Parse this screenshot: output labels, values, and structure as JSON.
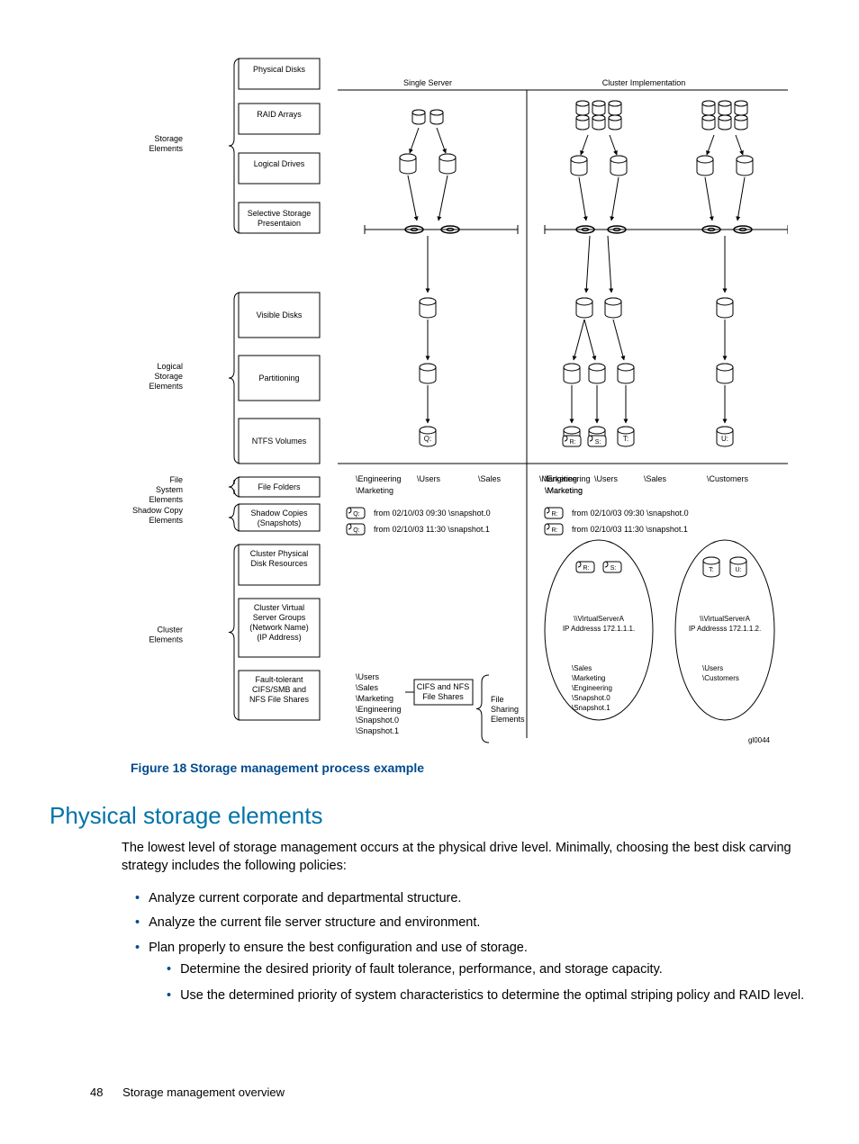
{
  "diagram": {
    "columns": {
      "single": "Single Server",
      "cluster": "Cluster Implementation"
    },
    "groups": {
      "storage": {
        "label": "Storage\nElements",
        "rows": [
          "Physical Disks",
          "RAID Arrays",
          "Logical Drives",
          "Selective Storage\nPresentaion"
        ]
      },
      "logical": {
        "label": "Logical\nStorage\nElements",
        "rows": [
          "Visible Disks",
          "Partitioning",
          "NTFS Volumes"
        ]
      },
      "fse": {
        "label": "File\nSystem\nElements",
        "row": "File Folders"
      },
      "sce": {
        "label": "Shadow Copy\nElements",
        "row": "Shadow Copies\n(Snapshots)"
      },
      "cluster": {
        "label": "Cluster\nElements",
        "rows": [
          "Cluster Physical\nDisk Resources",
          "Cluster Virtual\nServer Groups\n(Network Name)\n(IP Address)",
          "Fault-tolerant\nCIFS/SMB and\nNFS File Shares"
        ]
      }
    },
    "vol_single": "Q:",
    "vol_cluster": [
      "R:",
      "S:",
      "T:",
      "U:"
    ],
    "folders_single": [
      "\\Engineering",
      "\\Users",
      "\\Sales",
      "\\Marketing"
    ],
    "folders_cluster_a": [
      "\\Engineering",
      "\\Users",
      "\\Sales",
      "\\Marketing"
    ],
    "folders_cluster_b": [
      "\\Customers"
    ],
    "snaps": [
      "from 02/10/03 09:30 \\snapshot.0",
      "from 02/10/03 11:30 \\snapshot.1"
    ],
    "snap_drive_single": "Q:",
    "snap_drive_cluster": "R:",
    "vserverA": "\\\\VirtualServerA\nIP Addresss 172.1.1.1.",
    "vserverB": "\\\\VirtualServerA\nIP Addresss 172.1.1.2.",
    "shares_single_list": [
      "\\Users",
      "\\Sales",
      "\\Marketing",
      "\\Engineering",
      "\\Snapshot.0",
      "\\Snapshot.1"
    ],
    "shares_single_box": "CIFS and NFS\nFile Shares",
    "shares_single_label": "File\nSharing\nElements",
    "shares_cluster_a": [
      "\\Sales",
      "\\Marketing",
      "\\Engineering",
      "\\Snapshot.0",
      "\\Snapshot.1"
    ],
    "shares_cluster_b": [
      "\\Users",
      "\\Customers"
    ],
    "ref": "gl0044"
  },
  "caption": "Figure 18 Storage management process example",
  "section_title": "Physical storage elements",
  "paragraph": "The lowest level of storage management occurs at the physical drive level. Minimally, choosing the best disk carving strategy includes the following policies:",
  "bullets": [
    "Analyze current corporate and departmental structure.",
    "Analyze the current file server structure and environment.",
    "Plan properly to ensure the best configuration and use of storage."
  ],
  "sub_bullets": [
    "Determine the desired priority of fault tolerance, performance, and storage capacity.",
    "Use the determined priority of system characteristics to determine the optimal striping policy and RAID level."
  ],
  "footer": {
    "page": "48",
    "chapter": "Storage management overview"
  }
}
